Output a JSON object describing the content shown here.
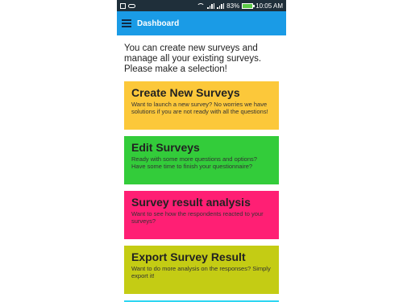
{
  "statusbar": {
    "network_label_1": "4G",
    "network_label_2": "4G",
    "battery_percent": "83%",
    "time": "10:05 AM",
    "battery_color": "#5cc947"
  },
  "appbar": {
    "title": "Dashboard",
    "color": "#1a9be6"
  },
  "intro": "You can create new surveys and manage all your existing surveys. Please make a selection!",
  "cards": [
    {
      "title": "Create New Surveys",
      "desc": "Want to launch a new survey? No worries we have solutions if you are not ready with all the questions!",
      "color": "#fcc83a"
    },
    {
      "title": "Edit Surveys",
      "desc": "Ready with some more questions and options? Have some time to finish your questionnaire?",
      "color": "#33cc3a"
    },
    {
      "title": "Survey result analysis",
      "desc": "Want to see how the respondents reacted to your surveys?",
      "color": "#ff1f74"
    },
    {
      "title": "Export Survey Result",
      "desc": "Want to do more analysis on the responses? Simply export it!",
      "color": "#c4cc14"
    },
    {
      "title": "",
      "desc": "",
      "color": "#2ed6f2"
    }
  ]
}
